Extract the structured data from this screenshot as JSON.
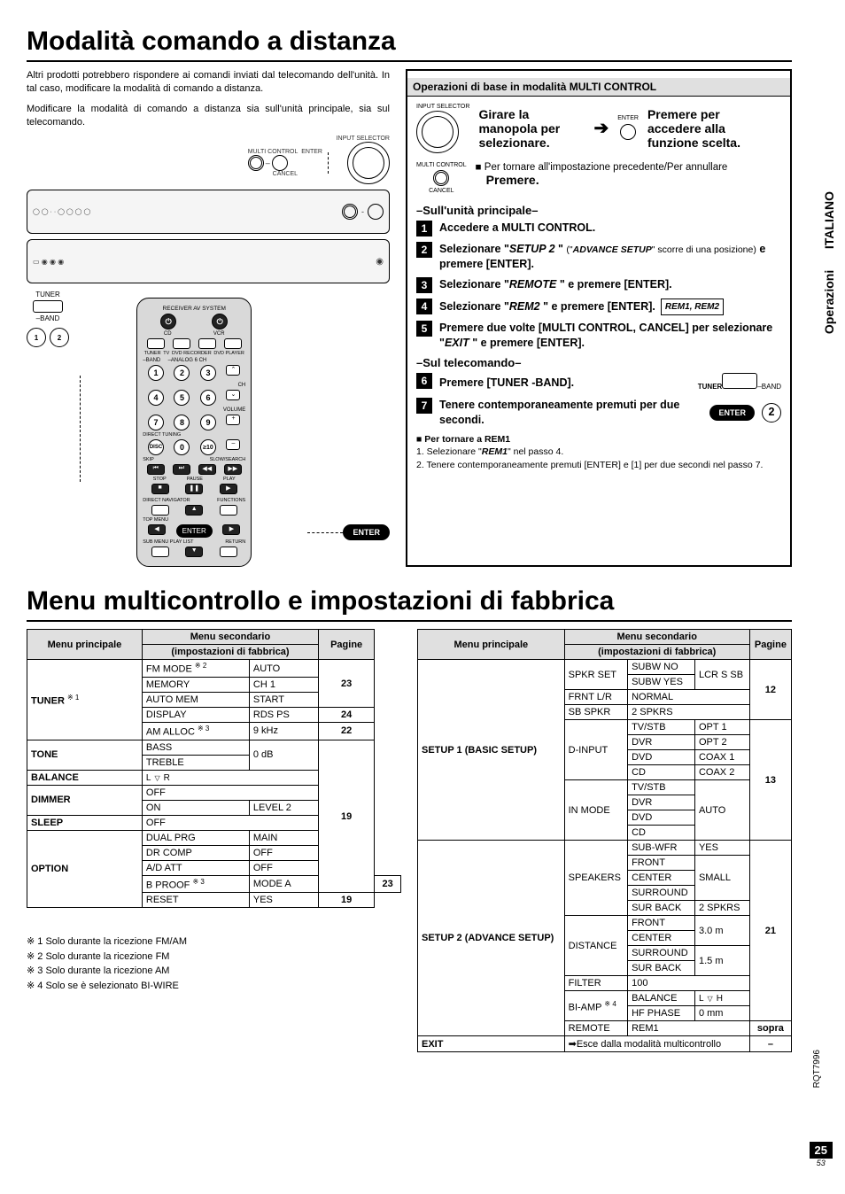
{
  "title1": "Modalità comando a distanza",
  "intro1": "Altri prodotti potrebbero rispondere ai comandi inviati dal telecomando dell'unità. In tal caso, modificare la modalità di comando a distanza.",
  "intro2": "Modificare la modalità di comando a distanza sia sull'unità principale, sia sul telecomando.",
  "diag": {
    "inputsel": "INPUT SELECTOR",
    "multi": "MULTI CONTROL",
    "enter": "ENTER",
    "cancel": "CANCEL",
    "tuner": "TUNER",
    "band": "BAND",
    "receiver": "RECEIVER  AV SYSTEM",
    "cd": "CD",
    "vcr": "VCR",
    "tv": "TV",
    "dvdrec": "DVD RECORDER",
    "dvdpl": "DVD PLAYER",
    "analog": "ANALOG 6 CH",
    "ch": "CH",
    "volume": "VOLUME",
    "directtune": "DIRECT TUNING",
    "disc": "DISC",
    "skip": "SKIP",
    "slow": "SLOW/SEARCH",
    "stop": "STOP",
    "pause": "PAUSE",
    "play": "PLAY",
    "directnav": "DIRECT NAVIGATOR",
    "functions": "FUNCTIONS",
    "topmenu": "TOP MENU",
    "submenu": "SUB MENU PLAY LIST",
    "return": "RETURN",
    "enterbtn": "ENTER"
  },
  "ops": {
    "header": "Operazioni di base in modalità MULTI CONTROL",
    "inputsel": "INPUT SELECTOR",
    "girare": "Girare la manopola per selezionare.",
    "enter": "ENTER",
    "premere": "Premere per accedere alla funzione scelta.",
    "multi": "MULTI CONTROL",
    "cancel": "CANCEL",
    "back": "■ Per tornare all'impostazione precedente/Per annullare",
    "backpress": "Premere.",
    "unitHd": "–Sull'unità principale–",
    "step1": "Accedere a MULTI CONTROL.",
    "step2a": "Selezionare \"",
    "step2b": "SETUP 2",
    "step2c": "\" (\"",
    "step2d": "ADVANCE SETUP",
    "step2e": "\" scorre di una posizione) ",
    "step2f": "e premere [ENTER].",
    "step3a": "Selezionare \"",
    "step3b": "REMOTE",
    "step3c": "\" e premere [ENTER].",
    "step4a": "Selezionare \"",
    "step4b": "REM2",
    "step4c": "\" e premere [ENTER].",
    "step4box": "REM1, REM2",
    "step5": "Premere due volte [MULTI CONTROL, CANCEL] per selezionare \"",
    "step5b": "EXIT",
    "step5c": "\" e premere [ENTER].",
    "remHd": "–Sul telecomando–",
    "step6": "Premere [TUNER -BAND].",
    "tunerlbl": "TUNER",
    "bandlbl": "BAND",
    "step7": "Tenere contemporaneamente premuti per due secondi.",
    "enterbtn": "ENTER",
    "noteHd": "■  Per tornare a REM1",
    "note1a": "1. Selezionare \"",
    "note1b": "REM1",
    "note1c": "\" nel passo 4.",
    "note2": "2. Tenere contemporaneamente premuti [ENTER] e [1] per due secondi nel passo 7."
  },
  "title2": "Menu multicontrollo e impostazioni di fabbrica",
  "thead": {
    "menu": "Menu principale",
    "sub": "Menu secondario",
    "subnote": "(impostazioni di fabbrica)",
    "page": "Pagine"
  },
  "left": {
    "tuner": "TUNER",
    "tuner_sup": "※ 1",
    "fm_a": "FM MODE",
    "fm_sup": "※ 2",
    "fm_b": "AUTO",
    "mem_a": "MEMORY",
    "mem_b": "CH 1",
    "am_a": "AUTO MEM",
    "am_b": "START",
    "disp_a": "DISPLAY",
    "disp_b": "RDS PS",
    "all_a": "AM ALLOC",
    "all_sup": "※ 3",
    "all_b": "9 kHz",
    "p23": "23",
    "p24": "24",
    "p22": "22",
    "tone": "TONE",
    "bass": "BASS",
    "treble": "TREBLE",
    "zdb": "0 dB",
    "bal": "BALANCE",
    "balL": "L",
    "balR": "R",
    "dim": "DIMMER",
    "off": "OFF",
    "on": "ON",
    "lvl2": "LEVEL 2",
    "p19": "19",
    "sleep": "SLEEP",
    "opt": "OPTION",
    "dual_a": "DUAL PRG",
    "dual_b": "MAIN",
    "dr_a": "DR COMP",
    "dr_b": "OFF",
    "ad_a": "A/D ATT",
    "ad_b": "OFF",
    "bp_a": "B PROOF",
    "bp_sup": "※ 3",
    "bp_b": "MODE A",
    "reset_a": "RESET",
    "reset_b": "YES"
  },
  "right": {
    "s1": "SETUP 1 (BASIC SETUP)",
    "spkr": "SPKR SET",
    "subno": "SUBW NO",
    "subyes": "SUBW YES",
    "lcr": "LCR S SB",
    "frnt": "FRNT L/R",
    "normal": "NORMAL",
    "sbspkr": "SB SPKR",
    "twospkr": "2 SPKRS",
    "p12": "12",
    "dinput": "D-INPUT",
    "tvstb": "TV/STB",
    "opt1": "OPT 1",
    "dvr": "DVR",
    "opt2": "OPT 2",
    "dvd": "DVD",
    "coax1": "COAX 1",
    "cd": "CD",
    "coax2": "COAX 2",
    "p13": "13",
    "inmode": "IN MODE",
    "auto": "AUTO",
    "s2": "SETUP 2 (ADVANCE SETUP)",
    "speakers": "SPEAKERS",
    "subwfr": "SUB-WFR",
    "yes": "YES",
    "front": "FRONT",
    "center": "CENTER",
    "small": "SMALL",
    "surround": "SURROUND",
    "surback": "SUR BACK",
    "p21": "21",
    "distance": "DISTANCE",
    "d30": "3.0 m",
    "d15": "1.5 m",
    "filter": "FILTER",
    "f100": "100",
    "biamp": "BI-AMP",
    "biamp_sup": "※ 4",
    "balance": "BALANCE",
    "balL": "L",
    "balH": "H",
    "hfphase": "HF PHASE",
    "mm0": "0 mm",
    "remote": "REMOTE",
    "rem1": "REM1",
    "sopra": "sopra",
    "exit": "EXIT",
    "exitnote": "➡Esce dalla modalità multicontrollo",
    "dash": "–"
  },
  "footnotes": {
    "f1": "※ 1 Solo durante la ricezione FM/AM",
    "f2": "※ 2 Solo durante la ricezione FM",
    "f3": "※ 3 Solo durante la ricezione AM",
    "f4": "※ 4 Solo se è selezionato BI-WIRE"
  },
  "sidebar": {
    "ops": "Operazioni",
    "lang": "ITALIANO"
  },
  "doccode": "RQT7996",
  "pagenum": "25",
  "pagesub": "53"
}
